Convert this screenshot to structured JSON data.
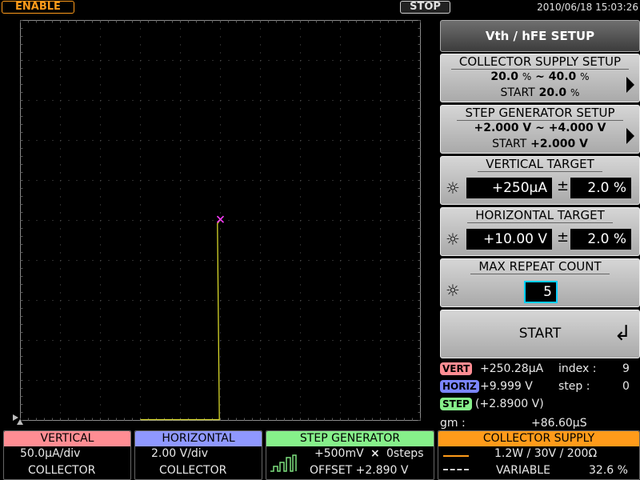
{
  "topbar": {
    "enable_label": "ENABLE",
    "stop_label": "STOP",
    "datetime": "2010/06/18 15:03:26"
  },
  "plot": {
    "grid_color": "#5a5a5a",
    "trace_color": "#d6d62a",
    "marker_color": "#ff3cff"
  },
  "chart_data": {
    "type": "line",
    "x_divisions": 10,
    "y_divisions": 10,
    "x_per_div": "2.00 V/div",
    "y_per_div": "50.0µA/div",
    "x_range_V": [
      0,
      20
    ],
    "y_range_uA": [
      0,
      500
    ],
    "series": [
      {
        "points": [
          [
            6.0,
            0
          ],
          [
            9.95,
            0
          ],
          [
            9.95,
            0
          ],
          [
            9.85,
            245
          ],
          [
            9.999,
            250.28
          ]
        ]
      }
    ],
    "marker": {
      "x": 9.999,
      "y": 250.28
    }
  },
  "panel": {
    "title": "Vth / hFE SETUP",
    "collector_supply": {
      "title": "COLLECTOR SUPPLY SETUP",
      "range_from": "20.0",
      "range_to": "40.0",
      "unit": "%",
      "tilde": "~",
      "start_label": "START",
      "start_value": "20.0"
    },
    "step_generator": {
      "title": "STEP GENERATOR SETUP",
      "range_from": "+2.000",
      "range_to": "+4.000",
      "unit": "V",
      "tilde": "~",
      "start_label": "START",
      "start_value": "+2.000"
    },
    "vertical_target": {
      "title": "VERTICAL TARGET",
      "value": "+250µA",
      "pm": "±",
      "tolerance": "2.0 %"
    },
    "horizontal_target": {
      "title": "HORIZONTAL TARGET",
      "value": "+10.00 V",
      "pm": "±",
      "tolerance": "2.0 %"
    },
    "max_repeat": {
      "title": "MAX REPEAT COUNT",
      "value": "5"
    },
    "start_label": "START"
  },
  "readouts": {
    "vert_tag": "VERT",
    "vert_value": "+250.28µA",
    "index_label": "index :",
    "index_value": "9",
    "horiz_tag": "HORIZ",
    "horiz_value": "+9.999  V",
    "step_label": "step :",
    "step_value": "0",
    "step_tag": "STEP",
    "step_tag_value": "(+2.8900  V)",
    "gm_label": "gm :",
    "gm_value": "+86.60µS"
  },
  "bottom": {
    "vertical": {
      "title": "VERTICAL",
      "line1": "50.0µA/div",
      "line2": "COLLECTOR",
      "color": "#ff8d93"
    },
    "horizontal": {
      "title": "HORIZONTAL",
      "line1": "2.00  V/div",
      "line2": "COLLECTOR",
      "color": "#8f98ff"
    },
    "step_generator": {
      "title": "STEP GENERATOR",
      "line1": "+500mV",
      "times": "×",
      "steps": "0steps",
      "line2": "OFFSET +2.890  V",
      "color": "#86f08a"
    },
    "collector_supply": {
      "title": "COLLECTOR SUPPLY",
      "line1": "1.2W / 30V / 200Ω",
      "line2_label": "VARIABLE",
      "line2_value": "32.6 %",
      "color": "#ff9b1a"
    }
  }
}
